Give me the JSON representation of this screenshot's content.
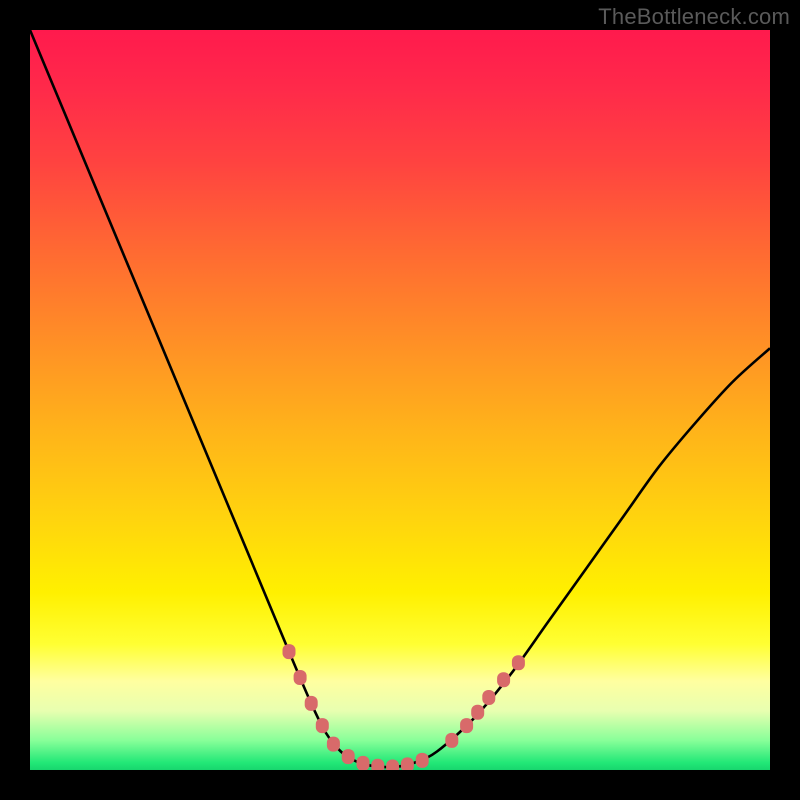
{
  "attribution": "TheBottleneck.com",
  "colors": {
    "frame": "#000000",
    "curve": "#000000",
    "marker": "#d86a6a",
    "gradient_top": "#ff1a4d",
    "gradient_bottom": "#18d66e"
  },
  "chart_data": {
    "type": "line",
    "title": "",
    "xlabel": "",
    "ylabel": "",
    "xlim": [
      0,
      100
    ],
    "ylim": [
      0,
      100
    ],
    "grid": false,
    "legend": false,
    "series": [
      {
        "name": "bottleneck-curve",
        "x": [
          0,
          5,
          10,
          15,
          20,
          25,
          30,
          35,
          38,
          40,
          42,
          44,
          46,
          48,
          50,
          52,
          55,
          60,
          65,
          70,
          75,
          80,
          85,
          90,
          95,
          100
        ],
        "y": [
          100,
          88,
          76,
          64,
          52,
          40,
          28,
          16,
          9,
          5,
          2.5,
          1.2,
          0.6,
          0.4,
          0.5,
          1,
          2.5,
          7,
          13,
          20,
          27,
          34,
          41,
          47,
          52.5,
          57
        ]
      }
    ],
    "markers": [
      {
        "x": 35,
        "y": 16
      },
      {
        "x": 36.5,
        "y": 12.5
      },
      {
        "x": 38,
        "y": 9
      },
      {
        "x": 39.5,
        "y": 6
      },
      {
        "x": 41,
        "y": 3.5
      },
      {
        "x": 43,
        "y": 1.8
      },
      {
        "x": 45,
        "y": 0.9
      },
      {
        "x": 47,
        "y": 0.5
      },
      {
        "x": 49,
        "y": 0.4
      },
      {
        "x": 51,
        "y": 0.7
      },
      {
        "x": 53,
        "y": 1.3
      },
      {
        "x": 57,
        "y": 4
      },
      {
        "x": 59,
        "y": 6
      },
      {
        "x": 60.5,
        "y": 7.8
      },
      {
        "x": 62,
        "y": 9.8
      },
      {
        "x": 64,
        "y": 12.2
      },
      {
        "x": 66,
        "y": 14.5
      }
    ],
    "annotations": []
  }
}
